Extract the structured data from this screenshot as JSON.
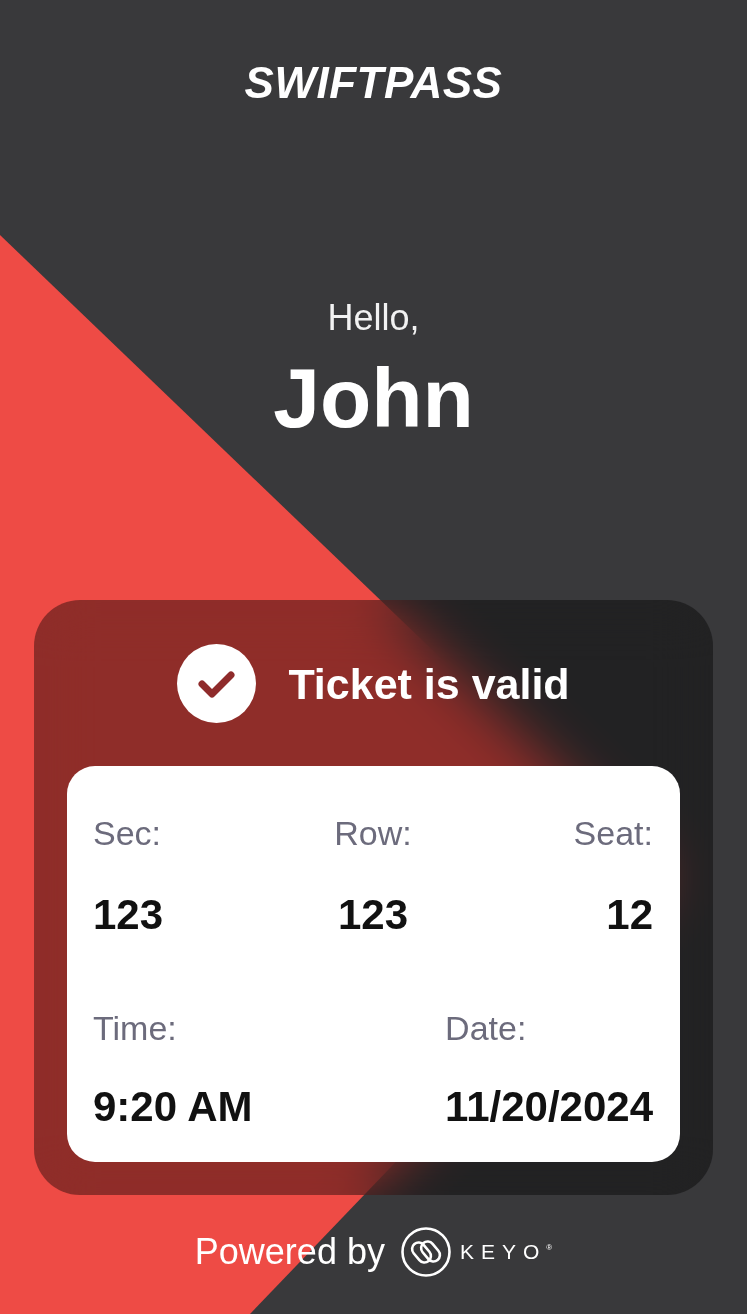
{
  "header": {
    "logo": "SWIFTPASS"
  },
  "greeting": {
    "salutation": "Hello,",
    "name": "John"
  },
  "ticket": {
    "status": {
      "valid": true,
      "label": "Ticket is valid"
    },
    "seating": [
      {
        "label": "Sec:",
        "value": "123"
      },
      {
        "label": "Row:",
        "value": "123"
      },
      {
        "label": "Seat:",
        "value": "12"
      }
    ],
    "schedule": [
      {
        "label": "Time:",
        "value": "9:20 AM"
      },
      {
        "label": "Date:",
        "value": "11/20/2024"
      }
    ]
  },
  "footer": {
    "powered_by": "Powered by",
    "brand": "KEYO$^{®}$"
  }
}
